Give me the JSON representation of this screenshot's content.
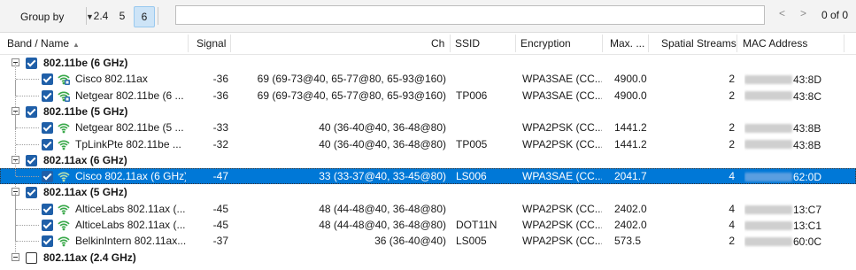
{
  "toolbar": {
    "group_by_label": "Group by",
    "bands": [
      {
        "label": "2.4",
        "active": false
      },
      {
        "label": "5",
        "active": false
      },
      {
        "label": "6",
        "active": true
      }
    ],
    "search_value": "",
    "count_text": "0 of 0",
    "prev_label": "<",
    "next_label": ">"
  },
  "columns": {
    "band_name": "Band / Name",
    "signal": "Signal",
    "ch": "Ch",
    "ssid": "SSID",
    "encryption": "Encryption",
    "max": "Max. ...",
    "streams": "Spatial Streams",
    "mac": "MAC Address"
  },
  "rows": [
    {
      "type": "group",
      "label": "802.11be (6 GHz)",
      "checked": true
    },
    {
      "type": "item",
      "name": "Cisco 802.11ax",
      "signal": "-36",
      "ch": "69 (69-73@40, 65-77@80, 65-93@160)",
      "ssid": "",
      "enc": "WPA3SAE (CC...",
      "max": "4900.0",
      "streams": "2",
      "mac": "43:8D",
      "icon": "wifi-lock-icon",
      "checked": true
    },
    {
      "type": "item",
      "name": "Netgear 802.11be (6 ...",
      "signal": "-36",
      "ch": "69 (69-73@40, 65-77@80, 65-93@160)",
      "ssid": "TP006",
      "enc": "WPA3SAE (CC...",
      "max": "4900.0",
      "streams": "2",
      "mac": "43:8C",
      "icon": "wifi-lock-icon",
      "checked": true
    },
    {
      "type": "group",
      "label": "802.11be (5 GHz)",
      "checked": true
    },
    {
      "type": "item",
      "name": "Netgear 802.11be (5 ...",
      "signal": "-33",
      "ch": "40 (36-40@40, 36-48@80)",
      "ssid": "",
      "enc": "WPA2PSK (CC...",
      "max": "1441.2",
      "streams": "2",
      "mac": "43:8B",
      "icon": "wifi-icon",
      "checked": true
    },
    {
      "type": "item",
      "name": "TpLinkPte 802.11be ...",
      "signal": "-32",
      "ch": "40 (36-40@40, 36-48@80)",
      "ssid": "TP005",
      "enc": "WPA2PSK (CC...",
      "max": "1441.2",
      "streams": "2",
      "mac": "43:8B",
      "icon": "wifi-icon",
      "checked": true
    },
    {
      "type": "group",
      "label": "802.11ax (6 GHz)",
      "checked": true
    },
    {
      "type": "item",
      "name": "Cisco 802.11ax (6 GHz)",
      "signal": "-47",
      "ch": "33 (33-37@40, 33-45@80)",
      "ssid": "LS006",
      "enc": "WPA3SAE (CC...",
      "max": "2041.7",
      "streams": "4",
      "mac": "62:0D",
      "icon": "wifi-icon",
      "checked": true,
      "selected": true
    },
    {
      "type": "group",
      "label": "802.11ax (5 GHz)",
      "checked": true
    },
    {
      "type": "item",
      "name": "AlticeLabs 802.11ax (...",
      "signal": "-45",
      "ch": "48 (44-48@40, 36-48@80)",
      "ssid": "",
      "enc": "WPA2PSK (CC...",
      "max": "2402.0",
      "streams": "4",
      "mac": "13:C7",
      "icon": "wifi-icon",
      "checked": true
    },
    {
      "type": "item",
      "name": "AlticeLabs 802.11ax (...",
      "signal": "-45",
      "ch": "48 (44-48@40, 36-48@80)",
      "ssid": "DOT11N",
      "enc": "WPA2PSK (CC...",
      "max": "2402.0",
      "streams": "4",
      "mac": "13:C1",
      "icon": "wifi-icon",
      "checked": true
    },
    {
      "type": "item",
      "name": "BelkinIntern 802.11ax...",
      "signal": "-37",
      "ch": "36 (36-40@40)",
      "ssid": "LS005",
      "enc": "WPA2PSK (CC...",
      "max": "573.5",
      "streams": "2",
      "mac": "60:0C",
      "icon": "wifi-icon",
      "checked": true
    },
    {
      "type": "group",
      "label": "802.11ax (2.4 GHz)",
      "checked": false
    }
  ],
  "colors": {
    "selection": "#0078d7",
    "checkbox": "#1f5fa8",
    "wifi_icon": "#3aa84a"
  }
}
